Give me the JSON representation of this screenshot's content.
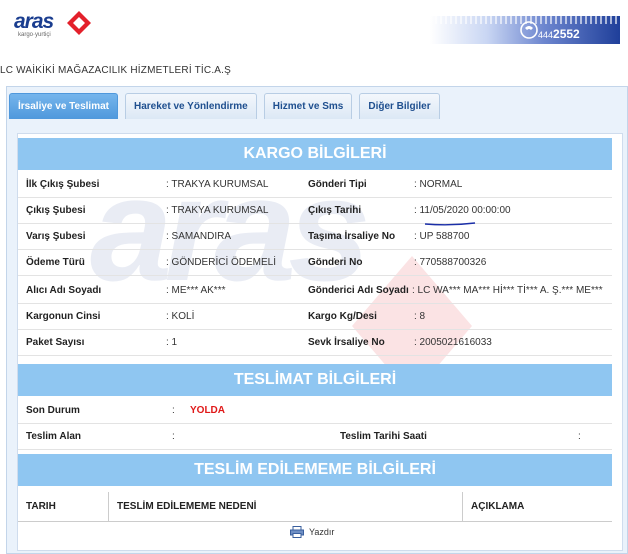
{
  "header": {
    "logo_text": "aras",
    "logo_sub": "kargo·yurtiçi",
    "phone_prefix": "444",
    "phone_suffix": "2552"
  },
  "company": "LC WAİKİKİ MAĞAZACILIK HİZMETLERİ TİC.A.Ş",
  "tabs": [
    {
      "label": "İrsaliye ve Teslimat",
      "active": true
    },
    {
      "label": "Hareket ve Yönlendirme",
      "active": false
    },
    {
      "label": "Hizmet ve Sms",
      "active": false
    },
    {
      "label": "Diğer Bilgiler",
      "active": false
    }
  ],
  "watermark": "aras",
  "kargo": {
    "title": "KARGO BİLGİLERİ",
    "rows": [
      {
        "l1": "İlk Çıkış Şubesi",
        "v1": ": TRAKYA KURUMSAL",
        "l2": "Gönderi Tipi",
        "v2": ": NORMAL"
      },
      {
        "l1": "Çıkış Şubesi",
        "v1": ": TRAKYA KURUMSAL",
        "l2": "Çıkış Tarihi",
        "v2": ": 11/05/2020 00:00:00"
      },
      {
        "l1": "Varış Şubesi",
        "v1": ": SAMANDIRA",
        "l2": "Taşıma İrsaliye No",
        "v2": ": UP 588700"
      },
      {
        "l1": "Ödeme Türü",
        "v1": ": GÖNDERİCİ ÖDEMELİ",
        "l2": "Gönderi No",
        "v2": ": 770588700326"
      },
      {
        "l1": "Alıcı Adı Soyadı",
        "v1": ": ME*** AK***",
        "l2": "Gönderici Adı Soyadı",
        "v2": ": LC WA*** MA*** Hİ*** Tİ*** A. Ş.*** ME***"
      },
      {
        "l1": "Kargonun Cinsi",
        "v1": ": KOLİ",
        "l2": "Kargo Kg/Desi",
        "v2": ": 8"
      },
      {
        "l1": "Paket Sayısı",
        "v1": ": 1",
        "l2": "Sevk İrsaliye No",
        "v2": ": 2005021616033"
      }
    ]
  },
  "teslimat": {
    "title": "TESLİMAT BİLGİLERİ",
    "son_durum_label": "Son Durum",
    "son_durum_colon": ":",
    "son_durum_value": "YOLDA",
    "teslim_alan_label": "Teslim Alan",
    "teslim_alan_value": ":",
    "teslim_tarihi_label": "Teslim Tarihi Saati",
    "teslim_tarihi_value": ":"
  },
  "edilememe": {
    "title": "TESLİM EDİLEMEME BİLGİLERİ",
    "columns": [
      "TARIH",
      "TESLİM EDİLEMEME NEDENİ",
      "AÇIKLAMA"
    ]
  },
  "print_label": "Yazdır",
  "colors": {
    "band": "#8fc6f1",
    "tab_active": "#4f98dc",
    "status": "#e01818"
  }
}
